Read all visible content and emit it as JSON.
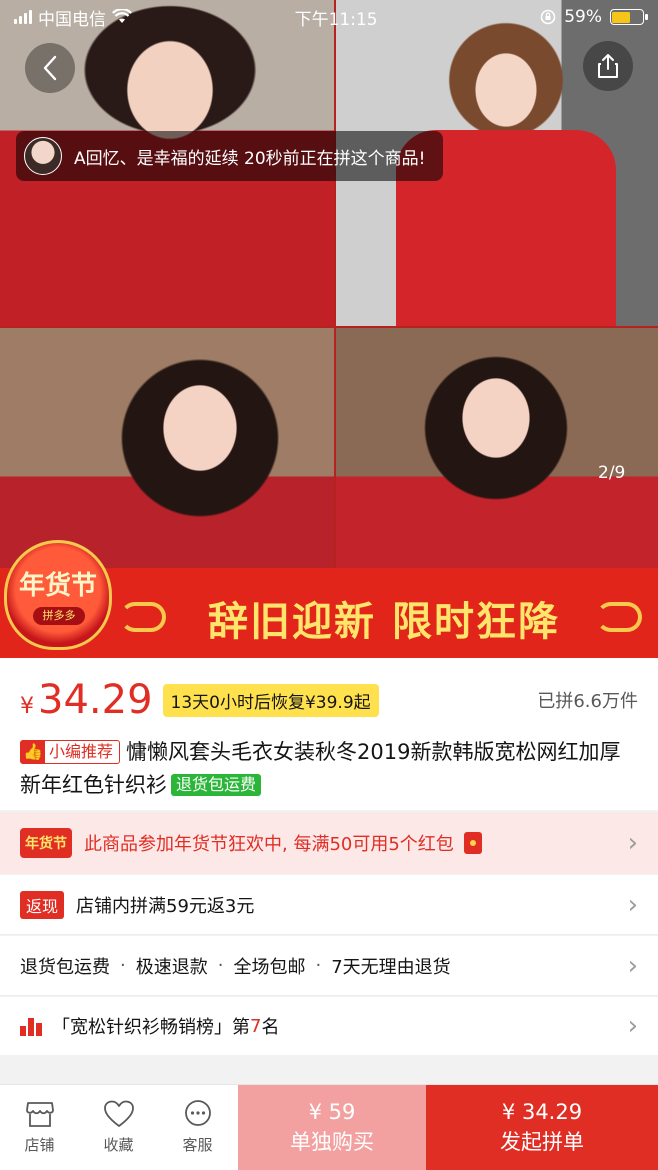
{
  "status_bar": {
    "carrier": "中国电信",
    "time": "下午11:15",
    "battery": "59%",
    "battery_level": 0.59
  },
  "gallery": {
    "notice_text": "A回忆、是幸福的延续 20秒前正在拼这个商品!",
    "pager": "2/9",
    "promo_lantern": "年货节",
    "promo_lantern_sub": "拼多多",
    "promo_slogan": "辞旧迎新 限时狂降"
  },
  "product": {
    "currency": "¥",
    "price": "34.29",
    "countdown": "13天0小时后恢复¥39.9起",
    "sold": "已拼6.6万件",
    "editor_tag": "小编推荐",
    "title": "慵懒风套头毛衣女装秋冬2019新款韩版宽松网红加厚新年红色针织衫",
    "refund_tag": "退货包运费"
  },
  "rows": {
    "festival_badge": "年货节",
    "festival_text": "此商品参加年货节狂欢中, 每满50可用5个红包",
    "cashback_badge": "返现",
    "cashback_text": "店铺内拼满59元返3元",
    "services": [
      "退货包运费",
      "极速退款",
      "全场包邮",
      "7天无理由退货"
    ],
    "rank_prefix": "「宽松针织衫畅销榜」第",
    "rank_number": "7",
    "rank_suffix": "名"
  },
  "bottom_bar": {
    "tabs": [
      "店铺",
      "收藏",
      "客服"
    ],
    "buy_alone_price": "¥ 59",
    "buy_alone_label": "单独购买",
    "buy_group_price": "¥ 34.29",
    "buy_group_label": "发起拼单"
  },
  "colors": {
    "brand_red": "#e02e24",
    "buy_alone_bg": "#f2a1a0",
    "countdown_bg": "#ffe14d",
    "refund_green": "#2bb63a"
  }
}
